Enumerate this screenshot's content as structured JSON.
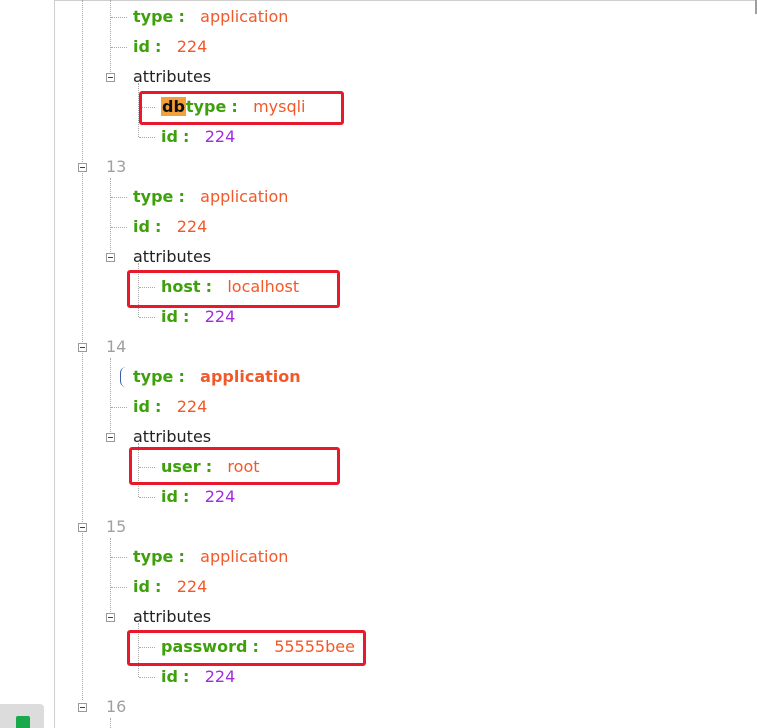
{
  "tree": {
    "block0": {
      "type_key": "type",
      "type_value": "application",
      "id_key": "id",
      "id_value": "224",
      "attributes_label": "attributes",
      "attr_key_highlight": "db",
      "attr_key_rest": "type",
      "attr_value": "mysqli",
      "attr_id_key": "id",
      "attr_id_value": "224"
    },
    "block13": {
      "index": "13",
      "type_key": "type",
      "type_value": "application",
      "id_key": "id",
      "id_value": "224",
      "attributes_label": "attributes",
      "attr_key": "host",
      "attr_value": "localhost",
      "attr_id_key": "id",
      "attr_id_value": "224"
    },
    "block14": {
      "index": "14",
      "type_key": "type",
      "type_value": "application",
      "id_key": "id",
      "id_value": "224",
      "attributes_label": "attributes",
      "attr_key": "user",
      "attr_value": "root",
      "attr_id_key": "id",
      "attr_id_value": "224"
    },
    "block15": {
      "index": "15",
      "type_key": "type",
      "type_value": "application",
      "id_key": "id",
      "id_value": "224",
      "attributes_label": "attributes",
      "attr_key": "password",
      "attr_value": "55555bee",
      "attr_id_key": "id",
      "attr_id_value": "224"
    },
    "block16": {
      "index": "16"
    }
  },
  "separator": ":",
  "colors": {
    "key": "#3ea00c",
    "string": "#f1592a",
    "number": "#a02be0",
    "index": "#a0a0a0",
    "highlight_box": "#e8192c",
    "search_highlight": "#f2a03a"
  },
  "icons": {
    "expand_toggle": "minus-square-icon",
    "status_badge": "shield-icon"
  }
}
